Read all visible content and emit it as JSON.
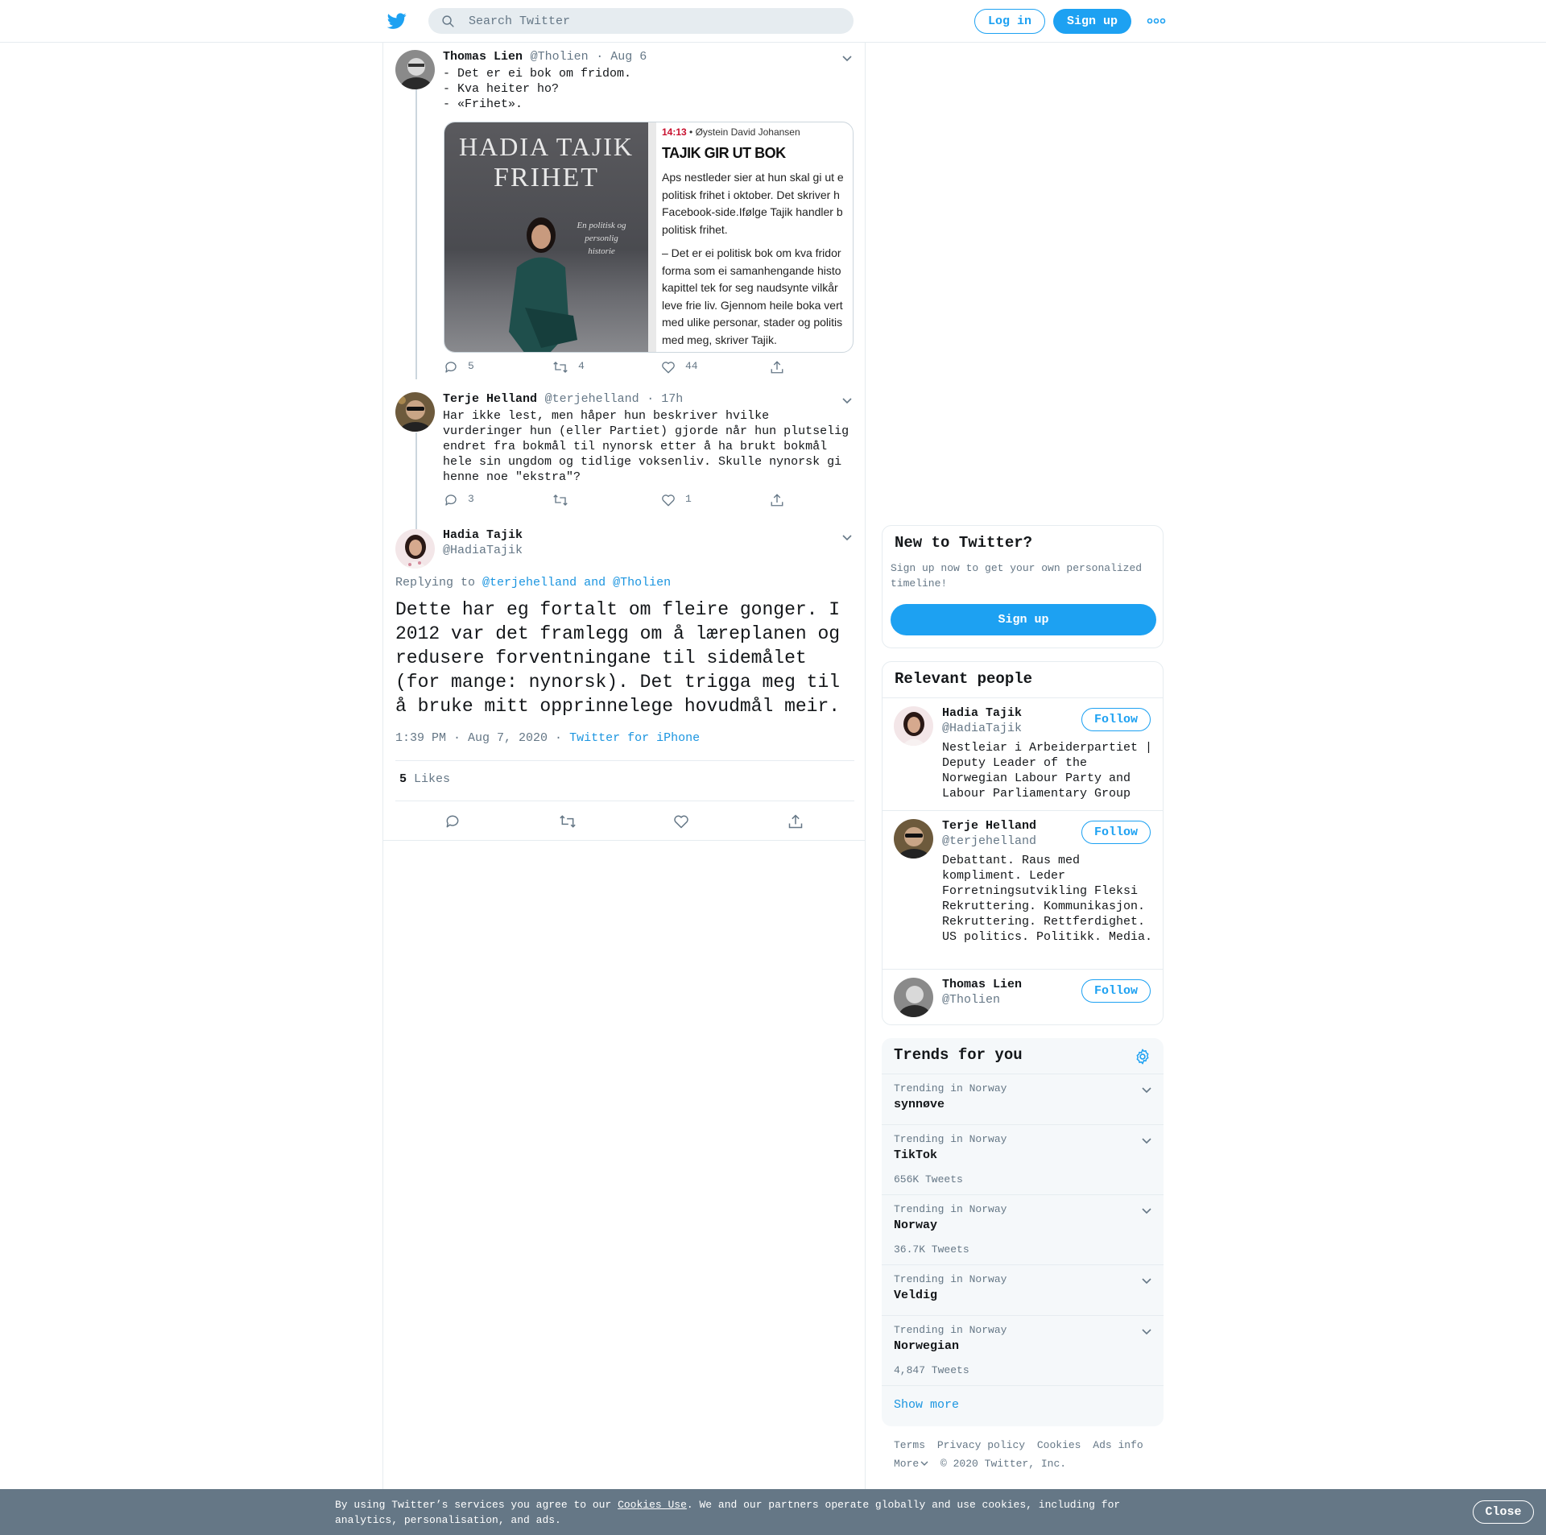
{
  "header": {
    "logo_icon": "twitter-bird-icon",
    "search_placeholder": "Search Twitter",
    "login_label": "Log in",
    "signup_label": "Sign up",
    "more_icon": "more-dots-icon"
  },
  "thread": {
    "tweets": [
      {
        "name": "Thomas Lien",
        "handle": "@Tholien",
        "time": "· Aug 6",
        "text": "- Det er ei bok om fridom.\n- Kva heiter ho?\n- «Frihet».",
        "replies": "5",
        "retweets": "4",
        "likes": "44",
        "media": {
          "book_author": "HADIA TAJIK",
          "book_title": "FRIHET",
          "book_subtitle": "En politisk og personlig historie",
          "article_time": "14:13",
          "article_author": "• Øystein David Johansen",
          "article_headline": "TAJIK GIR UT BOK",
          "article_p1_lines": [
            "Aps nestleder sier at hun skal gi ut e",
            "politisk frihet i oktober. Det skriver h",
            "Facebook-side.Ifølge Tajik handler b",
            "politisk frihet."
          ],
          "article_p2_lines": [
            "– Det er ei politisk bok om kva fridor",
            "forma som ei samanhengande histo",
            "kapittel tek for seg naudsynte vilkår",
            "leve frie liv. Gjennom heile boka vert",
            "med ulike personar, stader og politis",
            "med meg, skriver Tajik."
          ]
        }
      },
      {
        "name": "Terje Helland",
        "handle": "@terjehelland",
        "time": "· 17h",
        "text": "Har ikke lest, men håper hun beskriver hvilke\nvurderinger hun (eller Partiet) gjorde når hun plutselig\nendret fra bokmål til nynorsk etter å ha brukt bokmål\nhele sin ungdom og tidlige voksenliv. Skulle nynorsk gi\nhenne noe \"ekstra\"?",
        "replies": "3",
        "retweets": "",
        "likes": "1"
      }
    ],
    "focus": {
      "name": "Hadia Tajik",
      "handle": "@HadiaTajik",
      "replying_label": "Replying to",
      "replying_users": "@terjehelland and @Tholien",
      "text": "Dette har eg fortalt om fleire gonger. I 2012 var det framlegg om å læreplanen og redusere forventningane til sidemålet (for mange: nynorsk). Det trigga meg til å bruke mitt opprinnelege hovudmål meir.",
      "timestamp": "1:39 PM · Aug 7, 2020 ·",
      "source": "Twitter for iPhone",
      "likes_count": "5",
      "likes_label": "Likes"
    }
  },
  "sidebar": {
    "new_to_twitter": {
      "title": "New to Twitter?",
      "text": "Sign up now to get your own personalized timeline!",
      "button": "Sign up"
    },
    "relevant": {
      "title": "Relevant people",
      "follow_label": "Follow",
      "people": [
        {
          "name": "Hadia Tajik",
          "handle": "@HadiaTajik",
          "bio": "Nestleiar i Arbeiderpartiet | Deputy Leader of the Norwegian Labour Party and Labour Parliamentary Group"
        },
        {
          "name": "Terje Helland",
          "handle": "@terjehelland",
          "bio": "Debattant. Raus med kompliment. Leder Forretningsutvikling Fleksi Rekruttering. Kommunikasjon. Rekruttering. Rettferdighet. US politics. Politikk. Media."
        },
        {
          "name": "Thomas Lien",
          "handle": "@Tholien",
          "bio": ""
        }
      ]
    },
    "trends": {
      "title": "Trends for you",
      "settings_icon": "gear-icon",
      "items": [
        {
          "context": "Trending in Norway",
          "name": "synnøve",
          "count": ""
        },
        {
          "context": "Trending in Norway",
          "name": "TikTok",
          "count": "656K Tweets"
        },
        {
          "context": "Trending in Norway",
          "name": "Norway",
          "count": "36.7K Tweets"
        },
        {
          "context": "Trending in Norway",
          "name": "Veldig",
          "count": ""
        },
        {
          "context": "Trending in Norway",
          "name": "Norwegian",
          "count": "4,847 Tweets"
        }
      ],
      "show_more": "Show more"
    },
    "footer": {
      "links": [
        "Terms",
        "Privacy policy",
        "Cookies",
        "Ads info"
      ],
      "more": "More",
      "copyright": "© 2020 Twitter, Inc."
    }
  },
  "cookie_bar": {
    "text_before": "By using Twitter’s services you agree to our ",
    "link": "Cookies Use",
    "text_after": ". We and our partners operate globally and use cookies, including for analytics, personalisation, and ads.",
    "close_label": "Close"
  },
  "colors": {
    "accent": "#1da1f2",
    "link": "#1b95e0",
    "secondary_text": "#657786",
    "border": "#e6ecf0",
    "cookie_bar": "#657786"
  }
}
